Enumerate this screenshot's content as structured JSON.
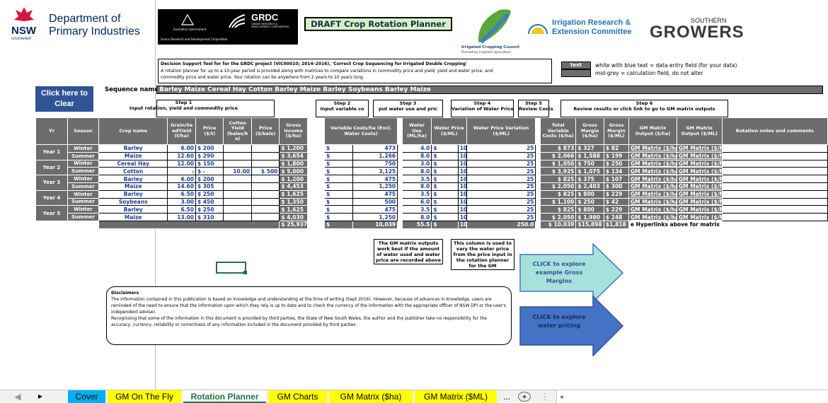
{
  "header": {
    "org1": "Department of",
    "org2": "Primary Industries",
    "nsw": "NSW",
    "nsw_sub": "GOVERNMENT",
    "grdc": "GRDC",
    "grdc_sub": "GRAINS RESEARCH & DEVELOPMENT CORPORATION",
    "aus_gov": "Australian Government",
    "aus_sub": "Grains Research and Development Corporation",
    "title": "DRAFT Crop Rotation Planner",
    "icc1": "Irrigated Cropping Council",
    "icc2": "Promoting irrigated agriculture",
    "irec1": "Irrigation Research &",
    "irec2": "Extension Committee",
    "sg1": "SOUTHERN",
    "sg2": "GROWERS"
  },
  "desc": {
    "line1": "Decision Support Tool for for the GRDC project (VIC00010; 2014–2016), 'Correct Crop Sequencing for Irrigated Double Cropping'",
    "line2": "A rotation planner for up to a 10-year period is provided along with matrices to compare variations in commodity price and yield; yield and water price; and",
    "line3": "commodity price and water price. Your rotation can be anywhere from 2 years to 10 years long."
  },
  "legend": {
    "swatch": "text",
    "line1": "white with blue text = data entry field (for your data)",
    "line2": "mid-grey = calculation field, do not alter"
  },
  "clear_button": "Click here to Clear",
  "sequence": {
    "label": "Sequence name:",
    "value": "Barley Maize Cereal Hay Cotton Barley Maize Barley Soybeans Barley Maize"
  },
  "steps": {
    "s1": "Step 1",
    "s1b": "Input rotation, yield and commodity price",
    "s2": "Step 2",
    "s2b": "Input variable co",
    "s3": "Step 3",
    "s3b": "put water use and pric",
    "s4": "Step 4",
    "s4b": "Variation of Water Price",
    "s5": "Step 5",
    "s5b": "Review Costs",
    "s6": "Step 6",
    "s6b": "Review results or click link to go to GM matrix outputs"
  },
  "headers": [
    "Yr",
    "Season",
    "Crop name",
    "Grain/Se edYield (t/ha)",
    "Price ($/t)",
    "Cotton Yield (bales/h a)",
    "Price ($/bale)",
    "Gross Income ($/ha)",
    "Variable Costs/ha (Excl. Water Costs)",
    "Water Use (ML/ha)",
    "Water Price ($/ML)",
    "Water Price Variation ($/ML)",
    "Total Variable Costs ($/ha)",
    "Gross Margin ($/ha)",
    "Gross Margin ($/ML)",
    "GM Matrix Output ($/ha)",
    "GM Matrix Output ($/ML)",
    "Rotation notes and comments"
  ],
  "rows": [
    {
      "yr": "Year 1",
      "season": "Winter",
      "crop": "Barley",
      "yield": "6.00",
      "price": "$ 200",
      "cy": "",
      "cp": "",
      "gi": "$ 1,200",
      "vc": "473",
      "wu": "4.0",
      "wp": "100",
      "wpv": "25",
      "tvc": "$ 873",
      "gm": "$ 327",
      "gmml": "$ 82",
      "o1": "GM Matrix ($/ha",
      "o2": "GM Matrix ($/ML"
    },
    {
      "yr": "",
      "season": "Summer",
      "crop": "Maize",
      "yield": "12.60",
      "price": "$ 290",
      "cy": "",
      "cp": "",
      "gi": "$ 3,654",
      "vc": "1,266",
      "wu": "8.0",
      "wp": "100",
      "wpv": "25",
      "tvc": "$ 2,066",
      "gm": "$ 1,588",
      "gmml": "$ 199",
      "o1": "GM Matrix ($/ha",
      "o2": "GM Matrix ($/ML"
    },
    {
      "yr": "Year 2",
      "season": "Winter",
      "crop": "Cereal Hay",
      "yield": "12.00",
      "price": "$ 150",
      "cy": "",
      "cp": "",
      "gi": "$ 1,800",
      "vc": "750",
      "wu": "3.0",
      "wp": "100",
      "wpv": "25",
      "tvc": "$ 1,050",
      "gm": "$ 750",
      "gmml": "$ 250",
      "o1": "GM Matrix ($/ha",
      "o2": "GM Matrix ($/ML"
    },
    {
      "yr": "",
      "season": "Summer",
      "crop": "Cotton",
      "yield": "-",
      "price": "$ -",
      "cy": "10.00",
      "cp": "$ 500",
      "gi": "$ 5,000",
      "vc": "3,125",
      "wu": "8.0",
      "wp": "100",
      "wpv": "25",
      "tvc": "$ 3,925",
      "gm": "$ 1,075",
      "gmml": "$ 134",
      "o1": "GM Matrix ($/ha",
      "o2": "GM Matrix ($/ML"
    },
    {
      "yr": "Year 3",
      "season": "Winter",
      "crop": "Barley",
      "yield": "6.00",
      "price": "$ 200",
      "cy": "",
      "cp": "",
      "gi": "$ 1,200",
      "vc": "475",
      "wu": "3.5",
      "wp": "100",
      "wpv": "25",
      "tvc": "$ 825",
      "gm": "$ 375",
      "gmml": "$ 107",
      "o1": "GM Matrix ($/ha",
      "o2": "GM Matrix ($/ML"
    },
    {
      "yr": "",
      "season": "Summer",
      "crop": "Maize",
      "yield": "14.60",
      "price": "$ 305",
      "cy": "",
      "cp": "",
      "gi": "$ 4,453",
      "vc": "1,250",
      "wu": "8.0",
      "wp": "100",
      "wpv": "25",
      "tvc": "$ 2,050",
      "gm": "$ 2,403",
      "gmml": "$ 300",
      "o1": "GM Matrix ($/ha",
      "o2": "GM Matrix ($/ML"
    },
    {
      "yr": "Year 4",
      "season": "Winter",
      "crop": "Barley",
      "yield": "6.50",
      "price": "$ 250",
      "cy": "",
      "cp": "",
      "gi": "$ 1,625",
      "vc": "475",
      "wu": "3.5",
      "wp": "100",
      "wpv": "25",
      "tvc": "$ 825",
      "gm": "$ 800",
      "gmml": "$ 229",
      "o1": "GM Matrix ($/ha",
      "o2": "GM Matrix ($/ML"
    },
    {
      "yr": "",
      "season": "Summer",
      "crop": "Soybeans",
      "yield": "3.00",
      "price": "$ 450",
      "cy": "",
      "cp": "",
      "gi": "$ 1,350",
      "vc": "500",
      "wu": "6.0",
      "wp": "100",
      "wpv": "25",
      "tvc": "$ 1,100",
      "gm": "$ 250",
      "gmml": "$ 42",
      "o1": "GM Matrix ($/ha",
      "o2": "GM Matrix ($/ML"
    },
    {
      "yr": "Year 5",
      "season": "Winter",
      "crop": "Barley",
      "yield": "6.50",
      "price": "$ 250",
      "cy": "",
      "cp": "",
      "gi": "$ 1,625",
      "vc": "475",
      "wu": "3.5",
      "wp": "100",
      "wpv": "25",
      "tvc": "$ 825",
      "gm": "$ 800",
      "gmml": "$ 229",
      "o1": "GM Matrix ($/ha",
      "o2": "GM Matrix ($/ML"
    },
    {
      "yr": "",
      "season": "Summer",
      "crop": "Maize",
      "yield": "13.00",
      "price": "$ 310",
      "cy": "",
      "cp": "",
      "gi": "$ 4,030",
      "vc": "1,250",
      "wu": "8.0",
      "wp": "100",
      "wpv": "25",
      "tvc": "$ 2,050",
      "gm": "$ 1,980",
      "gmml": "$ 248",
      "o1": "GM Matrix ($/ha",
      "o2": "GM Matrix ($/ML"
    }
  ],
  "totals": {
    "gi": "$ 25,937",
    "vc": "10,039",
    "wu": "55.5",
    "wp": "100",
    "wpv": "250.0",
    "tvc": "$ 10,039",
    "gm": "$15,898",
    "gmml": "$1,818",
    "note": "e Hyperlinks above for matrix resu"
  },
  "notes": {
    "n3": "The GM matrix outputs work best if the amount of water used and water price are recorded above",
    "n4": "This column is used to vary the water price from the price input in the rotation planner for the GM"
  },
  "arrows": {
    "a1": "CLICK to explore example Gross Margins",
    "a2": "CLICK to explore water pricing"
  },
  "disclaimer": {
    "title": "Disclaimers",
    "p1": "The information contained in this publication is based on knowledge and understanding at the time of writing (Sept 2016). However, because of advances in knowledge, users are reminded of the need to ensure that the information upon which they rely is up to date and to check the currency of the information with the appropriate officer of NSW DPI or the user's independent adviser.",
    "p2": "Recognising that some of the information in this document is provided by third parties, the State of New South Wales, the author and the publisher take no responsibility for the accuracy, currency, reliability or correctness of any information included in the document provided by third parties."
  },
  "tabs": [
    "Cover",
    "GM On The Fly",
    "Rotation Planner",
    "GM Charts",
    "GM Matrix ($ha)",
    "GM Matrix ($ML)",
    "...",
    "+"
  ],
  "colors": {
    "cover": "#00b0f0",
    "yellow": "#ffff00",
    "green_arrow": "#a8e0dc",
    "blue_arrow": "#4472c4",
    "clear": "#2f5496"
  }
}
